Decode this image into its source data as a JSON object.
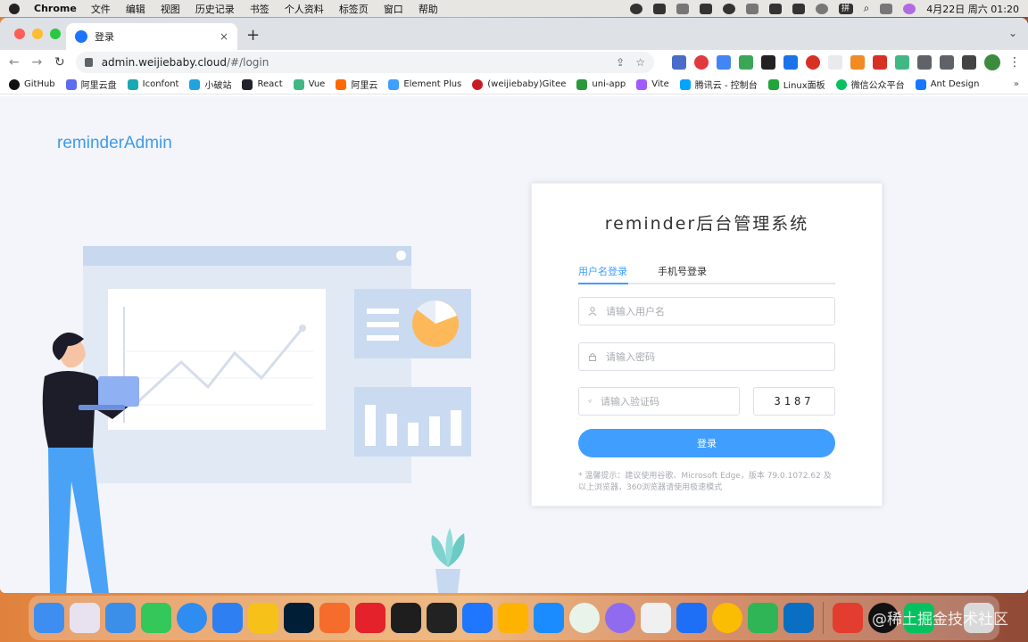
{
  "menubar": {
    "app_name": "Chrome",
    "items": [
      "文件",
      "编辑",
      "视图",
      "历史记录",
      "书签",
      "个人资料",
      "标签页",
      "窗口",
      "帮助"
    ],
    "clock": "4月22日 周六 01:20",
    "input_method": "拼"
  },
  "browser": {
    "tab_title": "登录",
    "tab_close": "×",
    "new_tab": "+",
    "tab_menu": "⌄",
    "url_host": "admin.weijiebaby.cloud",
    "url_path": "/#/login",
    "bookmarks": [
      {
        "label": "GitHub",
        "color": "#111111"
      },
      {
        "label": "阿里云盘",
        "color": "#5b6cf0"
      },
      {
        "label": "Iconfont",
        "color": "#19a9b5"
      },
      {
        "label": "小破站",
        "color": "#21a3e0"
      },
      {
        "label": "React",
        "color": "#20232a"
      },
      {
        "label": "Vue",
        "color": "#41b883"
      },
      {
        "label": "阿里云",
        "color": "#ff6a00"
      },
      {
        "label": "Element Plus",
        "color": "#409eff"
      },
      {
        "label": "(weijiebaby)Gitee",
        "color": "#c71d23"
      },
      {
        "label": "uni-app",
        "color": "#2b9939"
      },
      {
        "label": "Vite",
        "color": "#a259ff"
      },
      {
        "label": "腾讯云 - 控制台",
        "color": "#00a4ff"
      },
      {
        "label": "Linux面板",
        "color": "#20a53a"
      },
      {
        "label": "微信公众平台",
        "color": "#07c160"
      },
      {
        "label": "Ant Design",
        "color": "#1677ff"
      }
    ],
    "bookmarks_more": "»"
  },
  "page": {
    "brand": "reminderAdmin",
    "login": {
      "title": "reminder后台管理系统",
      "tabs": [
        "用户名登录",
        "手机号登录"
      ],
      "active_tab": 0,
      "username_placeholder": "请输入用户名",
      "password_placeholder": "请输入密码",
      "code_placeholder": "请输入验证码",
      "captcha": "3187",
      "submit": "登录",
      "tip": "* 温馨提示：建议使用谷歌、Microsoft Edge，版本 79.0.1072.62 及以上浏览器，360浏览器请使用极速模式"
    }
  },
  "watermark": "@稀土掘金技术社区",
  "colors": {
    "primary": "#409eff",
    "brand": "#3d9be9",
    "page_bg": "#f3f5fb"
  }
}
